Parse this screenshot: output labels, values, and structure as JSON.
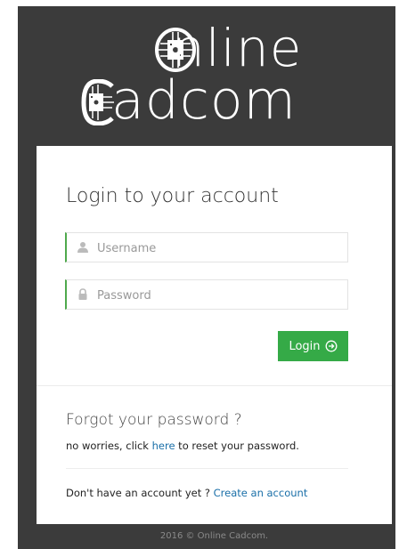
{
  "logo": {
    "word1": "nline",
    "word2": "adcom",
    "brand_color": "#ffffff",
    "chip_icon": "circuit-chip-icon"
  },
  "login": {
    "title": "Login to your account",
    "username_placeholder": "Username",
    "username_value": "",
    "username_icon": "user-icon",
    "password_placeholder": "Password",
    "password_value": "",
    "password_icon": "lock-icon",
    "submit_label": "Login",
    "submit_icon": "arrow-circle-right-icon",
    "accent_color": "#35aa47"
  },
  "forgot": {
    "title": "Forgot your password ?",
    "text_before": "no worries, click ",
    "link": "here",
    "text_after": " to reset your password."
  },
  "signup": {
    "text": "Don't have an account yet ? ",
    "link": "Create an account",
    "link_color": "#1a6fa8"
  },
  "footer": {
    "text": "2016 © Online Cadcom."
  }
}
